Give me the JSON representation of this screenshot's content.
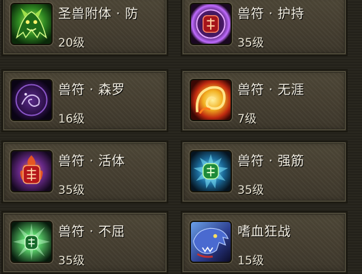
{
  "skills": [
    {
      "name": "圣兽附体 · 防",
      "level": "20级",
      "icon": "green-dragon-icon"
    },
    {
      "name": "兽符 · 护持",
      "level": "35级",
      "icon": "red-talisman-icon"
    },
    {
      "name": "兽符 · 森罗",
      "level": "16级",
      "icon": "purple-spirit-icon"
    },
    {
      "name": "兽符 · 无涯",
      "level": "7级",
      "icon": "flame-swirl-icon"
    },
    {
      "name": "兽符 · 活体",
      "level": "35级",
      "icon": "fire-talisman-icon"
    },
    {
      "name": "兽符 · 强筋",
      "level": "35级",
      "icon": "green-talisman-icon"
    },
    {
      "name": "兽符 · 不屈",
      "level": "35级",
      "icon": "glowing-rune-icon"
    },
    {
      "name": "嗜血狂战",
      "level": "15级",
      "icon": "blue-beast-icon"
    }
  ],
  "colors": {
    "card": "#463f31",
    "text": "#f2eee2"
  }
}
